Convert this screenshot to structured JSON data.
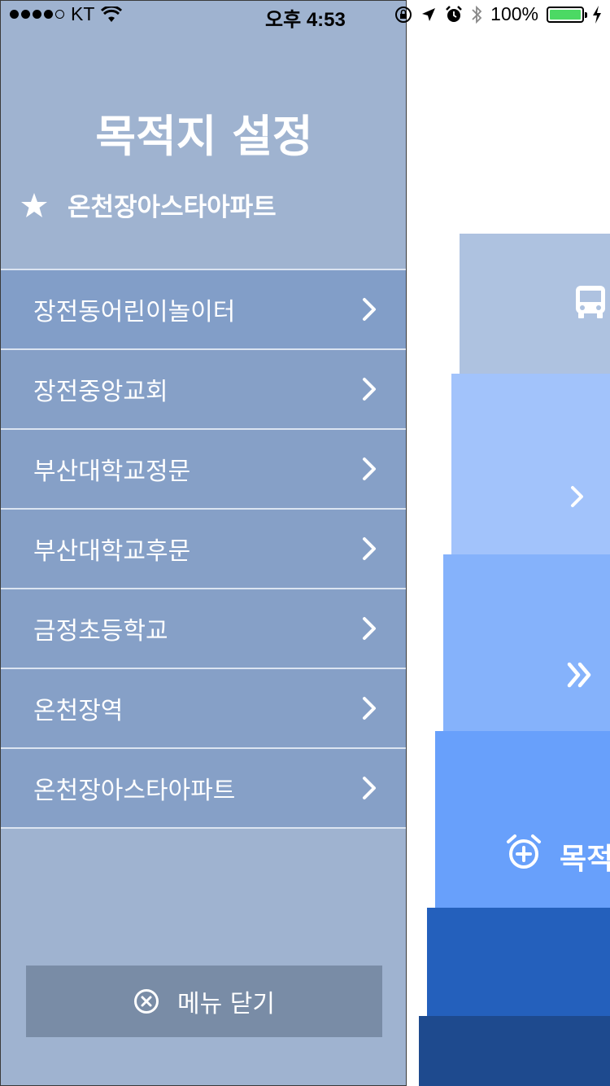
{
  "status_bar": {
    "carrier": "KT",
    "time": "오후 4:53",
    "battery_percent": "100%",
    "battery_level": 1.0,
    "battery_color": "#4cd964",
    "icons": [
      "signal-dots",
      "wifi-icon",
      "lock-rotation-icon",
      "location-arrow-icon",
      "alarm-icon",
      "bluetooth-icon",
      "battery-icon",
      "charging-bolt-icon"
    ]
  },
  "drawer": {
    "title": "목적지 설정",
    "favorite": {
      "icon": "star-icon",
      "label": "온천장아스타아파트"
    },
    "destinations": [
      {
        "label": "장전동어린이놀이터"
      },
      {
        "label": "장전중앙교회"
      },
      {
        "label": "부산대학교정문"
      },
      {
        "label": "부산대학교후문"
      },
      {
        "label": "금정초등학교"
      },
      {
        "label": "온천장역"
      },
      {
        "label": "온천장아스타아파트"
      }
    ],
    "close_button": {
      "icon": "close-circle-icon",
      "label": "메뉴 닫기"
    }
  },
  "background": {
    "blocks": [
      {
        "icon": "bus-icon",
        "color": "#aec2e0"
      },
      {
        "icon": "chevron-right-icon",
        "color": "#a2c3fb"
      },
      {
        "icon": "double-chevron-right-icon",
        "color": "#85b2fb"
      },
      {
        "icon": "alarm-add-icon",
        "label": "목적",
        "color": "#68a0fb"
      },
      {
        "color": "#2460bc"
      },
      {
        "color": "#1e4a8e"
      }
    ]
  },
  "colors": {
    "drawer_bg": "#9fb3d0",
    "list_item_bg": "#86a0c7",
    "close_button_bg": "#798ca6",
    "divider": "#dbe4f1"
  }
}
